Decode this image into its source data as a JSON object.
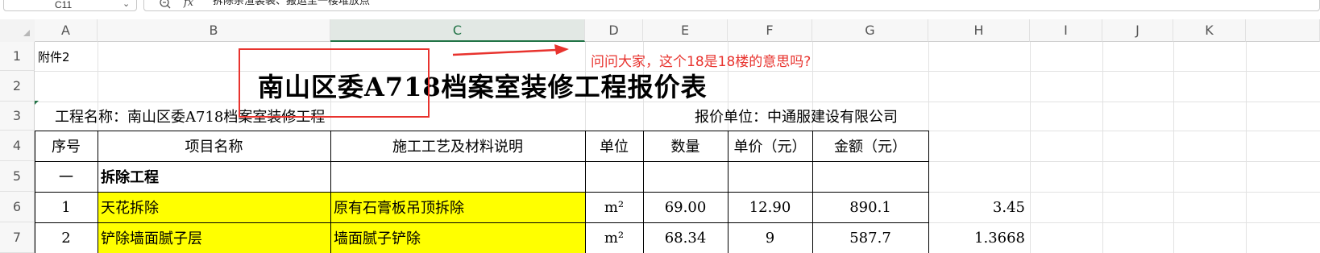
{
  "formula_bar": {
    "name_box": "C11",
    "formula_text": "拆除杂渣装袋、搬运至一楼堆放点"
  },
  "column_headers": [
    "A",
    "B",
    "C",
    "D",
    "E",
    "F",
    "G",
    "H",
    "I",
    "J",
    "K"
  ],
  "selected_column": "C",
  "row_headers": [
    "1",
    "2",
    "3",
    "4",
    "5",
    "6",
    "7"
  ],
  "sheet": {
    "a1": "附件2",
    "title": "南山区委A718档案室装修工程报价表",
    "project_name": "工程名称：南山区委A718档案室装修工程",
    "quote_unit": "报价单位：中通服建设有限公司",
    "table_headers": {
      "seq": "序号",
      "item": "项目名称",
      "desc": "施工工艺及材料说明",
      "unit": "单位",
      "qty": "数量",
      "price": "单价（元）",
      "amount": "金额（元）"
    },
    "section": {
      "seq": "一",
      "name": "拆除工程"
    },
    "rows": [
      {
        "seq": "1",
        "item": "天花拆除",
        "desc": "原有石膏板吊顶拆除",
        "unit": "m²",
        "qty": "69.00",
        "price": "12.90",
        "amount": "890.1",
        "h": "3.45"
      },
      {
        "seq": "2",
        "item": "铲除墙面腻子层",
        "desc": "墙面腻子铲除",
        "unit": "m²",
        "qty": "68.34",
        "price": "9",
        "amount": "587.7",
        "h": "1.3668"
      }
    ]
  },
  "annotation": {
    "text": "问问大家，这个18是18楼的意思吗?",
    "color": "#e8332e"
  },
  "colors": {
    "highlight": "#ffff00",
    "accent_green": "#217346"
  }
}
